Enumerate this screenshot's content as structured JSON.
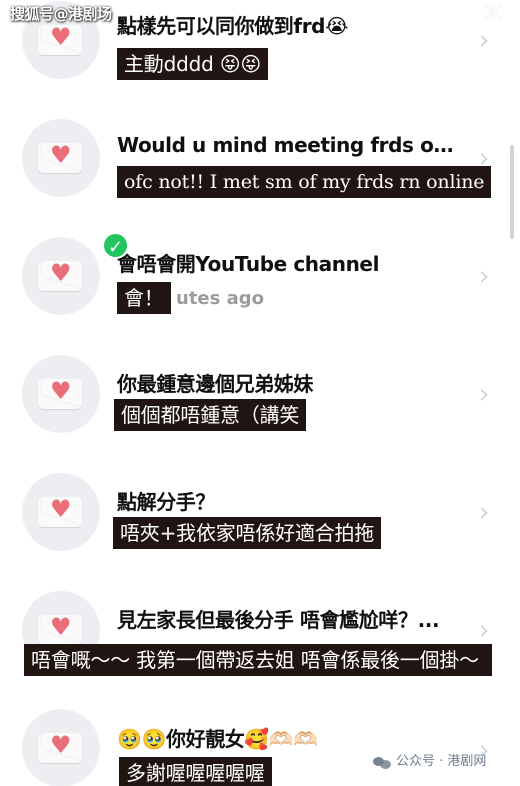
{
  "header": {
    "watermark": "搜狐号@港剧场",
    "close_icon": "close-icon"
  },
  "items": [
    {
      "question": "點樣先可以同你做到frd😭",
      "answer": "主動dddd 😝😝",
      "avatar_icon": "heart-envelope-icon",
      "chevron_icon": "chevron-right-icon"
    },
    {
      "question": "Would u mind meeting frds onlin...",
      "answer": "ofc not!! I met sm of my frds rn online",
      "avatar_icon": "heart-envelope-icon",
      "chevron_icon": "chevron-right-icon"
    },
    {
      "question": "會唔會開YouTube channel",
      "answer": "會！",
      "time": "utes ago",
      "avatar_icon": "heart-envelope-icon",
      "badge_icon": "check-icon",
      "chevron_icon": "chevron-right-icon"
    },
    {
      "question": "你最鍾意邊個兄弟姊妹",
      "answer": "個個都唔鍾意（講笑",
      "avatar_icon": "heart-envelope-icon",
      "chevron_icon": "chevron-right-icon"
    },
    {
      "question": "點解分手？",
      "answer": "唔夾+我依家唔係好適合拍拖",
      "avatar_icon": "heart-envelope-icon",
      "chevron_icon": "chevron-right-icon"
    },
    {
      "question": "見左家長但最後分手 唔會尷尬咩？...",
      "answer": "唔會嘅～～ 我第一個帶返去姐 唔會係最後一個掛～",
      "avatar_icon": "heart-envelope-icon",
      "chevron_icon": "chevron-right-icon"
    },
    {
      "question": "🥹🥹你好靚女🥰🫶🏻🫶🏻",
      "answer": "多謝喔喔喔喔喔",
      "avatar_icon": "heart-envelope-icon",
      "chevron_icon": "chevron-right-icon"
    }
  ],
  "footer": {
    "watermark": "公众号 · 港剧网",
    "wechat_icon": "wechat-icon"
  },
  "colors": {
    "answer_background": "#201513",
    "verified_green": "#23c55e",
    "heart_pink": "#ec6d7a",
    "avatar_background": "#eceef1"
  }
}
